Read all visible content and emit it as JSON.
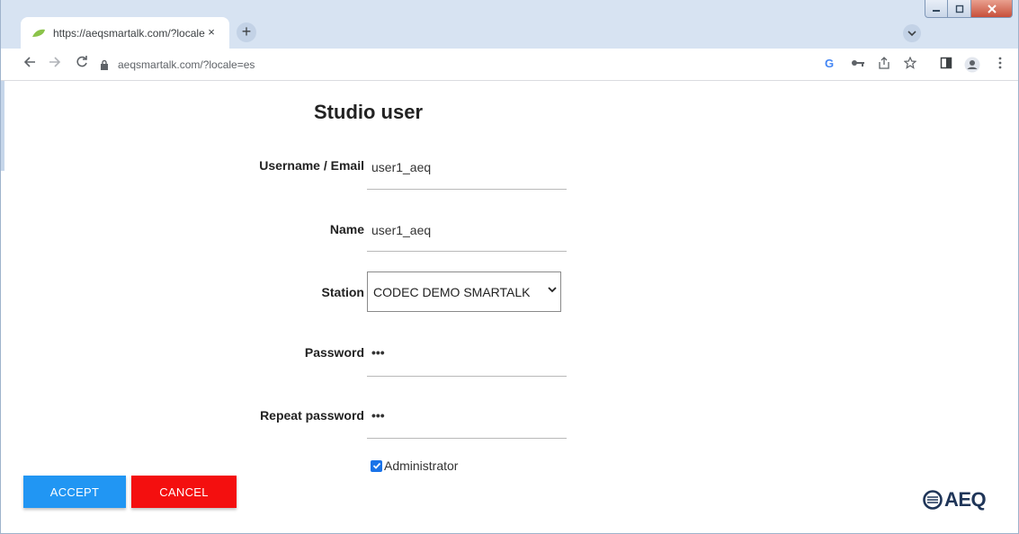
{
  "browser": {
    "tab_title": "https://aeqsmartalk.com/?locale",
    "tab_close": "×",
    "new_tab": "+",
    "url": "aeqsmartalk.com/?locale=es"
  },
  "form": {
    "title": "Studio user",
    "username_label": "Username / Email",
    "username_value": "user1_aeq",
    "name_label": "Name",
    "name_value": "user1_aeq",
    "station_label": "Station",
    "station_value": "CODEC DEMO SMARTALK",
    "password_label": "Password",
    "password_value": "•••",
    "repeat_password_label": "Repeat password",
    "repeat_password_value": "•••",
    "admin_label": "Administrator",
    "admin_checked": true
  },
  "buttons": {
    "accept": "ACCEPT",
    "cancel": "CANCEL"
  },
  "logo": {
    "text": "AEQ"
  },
  "colors": {
    "accept": "#2196f3",
    "cancel": "#f40f0f",
    "checkbox": "#1a73e8",
    "logo": "#1f3558"
  }
}
